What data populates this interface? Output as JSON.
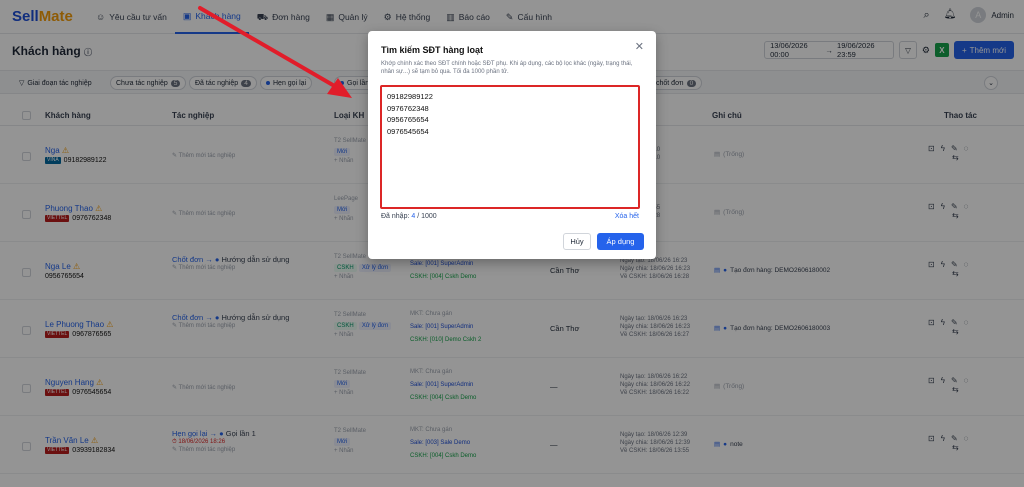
{
  "app": {
    "logo_a": "Sell",
    "logo_b": "Mate"
  },
  "nav": [
    {
      "label": "Yêu cầu tư vấn",
      "icon": "chat-icon"
    },
    {
      "label": "Khách hàng",
      "icon": "users-icon"
    },
    {
      "label": "Đơn hàng",
      "icon": "cart-icon"
    },
    {
      "label": "Quản lý",
      "icon": "grid-icon"
    },
    {
      "label": "Hệ thống",
      "icon": "gear-icon"
    },
    {
      "label": "Báo cáo",
      "icon": "chart-icon"
    },
    {
      "label": "Cấu hình",
      "icon": "wrench-icon"
    }
  ],
  "user": {
    "avatar_letter": "A",
    "name": "Admin"
  },
  "page": {
    "title": "Khách hàng"
  },
  "toolbar": {
    "date_from": "13/06/2026 00:00",
    "date_sep": "→",
    "date_to": "19/06/2026 23:59",
    "excel_label": "X",
    "add_label": "Thêm mới"
  },
  "filters": {
    "stage_label": "Giai đoạn tác nghiệp",
    "chips": [
      {
        "label": "Chưa tác nghiệp",
        "count": "5"
      },
      {
        "label": "Đã tác nghiệp",
        "count": "4"
      },
      {
        "label": "Hẹn gọi lại",
        "count": ""
      },
      {
        "label": "Gọi lần",
        "count": ""
      },
      {
        "label": "chốt đơn",
        "count": "0"
      }
    ]
  },
  "columns": [
    "Khách hàng",
    "Tác nghiệp",
    "Loại KH",
    "Ghi chú",
    "Thao tác"
  ],
  "rows": [
    {
      "name": "Nga",
      "carrier": "VINA",
      "phone": "09182989122",
      "tn_main": "",
      "tn_sub": "Thêm mới tác nghiệp",
      "loai_src": "T2 SellMate",
      "loai_tag": "Mới",
      "loai_tag2": "",
      "loai_add": "+ Nhãn",
      "mkt": "",
      "sale": "",
      "cskh": "",
      "city": "",
      "dates": [
        "18/06/26 22:10",
        "18/06/26 22:10"
      ],
      "note": "(Trống)",
      "note_muted": true
    },
    {
      "name": "Phuong Thao",
      "carrier": "VIETTEL",
      "phone": "0976762348",
      "tn_main": "",
      "tn_sub": "Thêm mới tác nghiệp",
      "loai_src": "LeePage",
      "loai_tag": "Mới",
      "loai_tag2": "",
      "loai_add": "+ Nhãn",
      "mkt": "",
      "sale": "",
      "cskh": "",
      "city": "",
      "dates": [
        "18/06/26 20:55",
        "18/06/26 10:28"
      ],
      "note": "(Trống)",
      "note_muted": true
    },
    {
      "name": "Nga Le",
      "carrier": "",
      "phone": "0956765654",
      "tn_main": "Chốt đơn",
      "tn_status": "Hướng dẫn sử dụng",
      "tn_sub": "Thêm mới tác nghiệp",
      "loai_src": "T2 SellMate",
      "loai_tag": "CSKH",
      "loai_tag2": "Xử lý đơn",
      "loai_add": "+ Nhãn",
      "mkt": "",
      "sale": "Sale: [001] SuperAdmin",
      "cskh": "CSKH: [004] Cskh Demo",
      "city": "Cần Thơ",
      "dates": [
        "Ngày tạo: 18/06/26 16:23",
        "Ngày chia: 18/06/26 16:23",
        "Về CSKH: 18/06/26 16:28"
      ],
      "note": "Tạo đơn hàng: DEMO2606180002",
      "note_muted": false
    },
    {
      "name": "Le Phuong Thao",
      "carrier": "VIETTEL",
      "phone": "0967876565",
      "tn_main": "Chốt đơn",
      "tn_status": "Hướng dẫn sử dụng",
      "tn_sub": "Thêm mới tác nghiệp",
      "loai_src": "T2 SellMate",
      "loai_tag": "CSKH",
      "loai_tag2": "Xử lý đơn",
      "loai_add": "+ Nhãn",
      "mkt": "MKT: Chưa gán",
      "sale": "Sale: [001] SuperAdmin",
      "cskh": "CSKH: [010] Demo Cskh 2",
      "city": "Cần Thơ",
      "dates": [
        "Ngày tạo: 18/06/26 16:23",
        "Ngày chia: 18/06/26 16:23",
        "Về CSKH: 18/06/26 16:27"
      ],
      "note": "Tạo đơn hàng: DEMO2606180003",
      "note_muted": false
    },
    {
      "name": "Nguyen Hang",
      "carrier": "VIETTEL",
      "phone": "0976545654",
      "tn_main": "",
      "tn_sub": "Thêm mới tác nghiệp",
      "loai_src": "T2 SellMate",
      "loai_tag": "Mới",
      "loai_tag2": "",
      "loai_add": "+ Nhãn",
      "mkt": "MKT: Chưa gán",
      "sale": "Sale: [001] SuperAdmin",
      "cskh": "CSKH: [004] Cskh Demo",
      "city": "—",
      "dates": [
        "Ngày tạo: 18/06/26 16:22",
        "Ngày chia: 18/06/26 16:22",
        "Về CSKH: 18/06/26 16:22"
      ],
      "note": "(Trống)",
      "note_muted": true
    },
    {
      "name": "Trần Văn Le",
      "carrier": "VIETTEL",
      "phone": "03939182834",
      "tn_main": "Hẹn gọi lại",
      "tn_status": "Gọi lần 1",
      "tn_time": "18/06/2026 18:26",
      "tn_sub": "Thêm mới tác nghiệp",
      "loai_src": "T2 SellMate",
      "loai_tag": "Mới",
      "loai_tag2": "",
      "loai_add": "+ Nhãn",
      "mkt": "MKT: Chưa gán",
      "sale": "Sale: [003] Sale Demo",
      "cskh": "CSKH: [004] Cskh Demo",
      "city": "—",
      "dates": [
        "Ngày tạo: 18/06/26 12:39",
        "Ngày chia: 18/06/26 12:39",
        "Về CSKH: 18/06/26 13:55"
      ],
      "note": "note",
      "note_muted": false
    }
  ],
  "modal": {
    "title": "Tìm kiếm SĐT hàng loạt",
    "description": "Khớp chính xác theo SĐT chính hoặc SĐT phụ. Khi áp dụng, các bộ lọc khác (ngày, trạng thái, nhân sự...) sẽ tạm bỏ qua. Tối đa 1000 phần tử.",
    "phones": "09182989122\n0976762348\n0956765654\n0976545654",
    "count_label": "Đã nhập:",
    "count_value": "4",
    "count_max": "/ 1000",
    "clear_label": "Xóa hết",
    "cancel_label": "Hủy",
    "apply_label": "Áp dụng"
  },
  "colors": {
    "primary": "#2563eb",
    "highlight": "#dc2626",
    "accent": "#f59e0b"
  }
}
